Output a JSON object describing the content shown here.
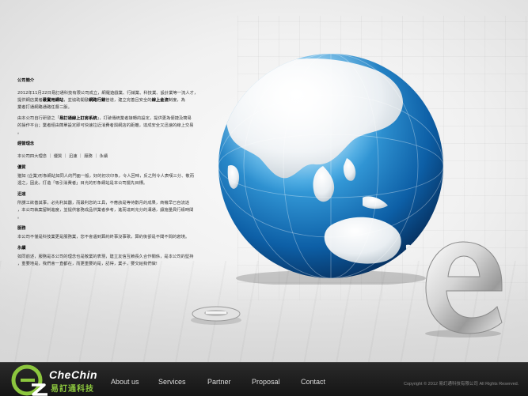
{
  "content": {
    "intro_title": "公司簡介",
    "intro_p1_a": "2012年11月22日易訂通科技有限公司成立，網羅遊戲業、行銷業、科技業、設計業等一流人才，",
    "intro_p1_b": "提供網店業者",
    "intro_p1_b_bold": "最實用網站",
    "intro_p1_c": "，並協助開發",
    "intro_p1_c_bold": "網路行銷",
    "intro_p1_d": "管道，建立完善且安全的",
    "intro_p1_d_bold": "線上金流",
    "intro_p1_e": "制度，為",
    "intro_p1_f": "業者打通網路通路任督二脈。",
    "intro_p2_a": "由本公司自行研發之「",
    "intro_p2_bold": "易訂通線上訂房系統",
    "intro_p2_b": "」，打破傳統業者接轉的設定，提供更為便捷及簡易",
    "intro_p2_c": "的操作平台；業者經由簡單設定即可快速拉近消費者與網店的距離，達成安全又迅速的線上交易",
    "intro_p2_d": "。",
    "philosophy_title": "經營理念",
    "philosophy_line": "本公司四大理念 ｜ 優質 ｜ 迅速 ｜ 服務 ｜ 永續",
    "quality_title": "優質",
    "quality_text_a": "猶如 (企業)形象網站如同人的門面一般，好的初次印象，令人回味，反之則令人表嘆三分、敬而",
    "quality_text_b": "遠之，因此，打造「吸引消費者」目光的形象網站是本公司擺先目標。",
    "speed_title": "迅速",
    "speed_text_a": "所謂工欲善其事，必先利其器，而最利您的工具，不應該是等待數月的成果，商機早已自流逝",
    "speed_text_b": "，本公司執案留制進度，並提供客務成品供業者參考，進而達到充分的溝通，讓施量員行級時間",
    "speed_text_c": "。",
    "service_title": "服務",
    "service_text": "本公司不僅是科技業更是服務業，您不會遇到算約終事沒事歌，算約後卻是不聞不問的窘境。",
    "forever_title": "永續",
    "forever_text_a": "如同前述，服務是本公司的理念也是敬業的表現，建立友信互賴長久合作關係，是本公司的堅持",
    "forever_text_b": "，重要地是，我們會一直都在，而更重要的是，記得，業子，要交給我們做!"
  },
  "footer": {
    "brand_en": "CheChin",
    "brand_zh": "易訂通科技",
    "nav": [
      "About us",
      "Services",
      "Partner",
      "Proposal",
      "Contact"
    ],
    "copyright": "Copyright © 2012 易訂通科技有限公司 All Rights Reserved."
  },
  "colors": {
    "footer_bg": "#1c1c1c",
    "brand_green": "#8cc63e",
    "globe_blue": "#1a7fc4"
  }
}
